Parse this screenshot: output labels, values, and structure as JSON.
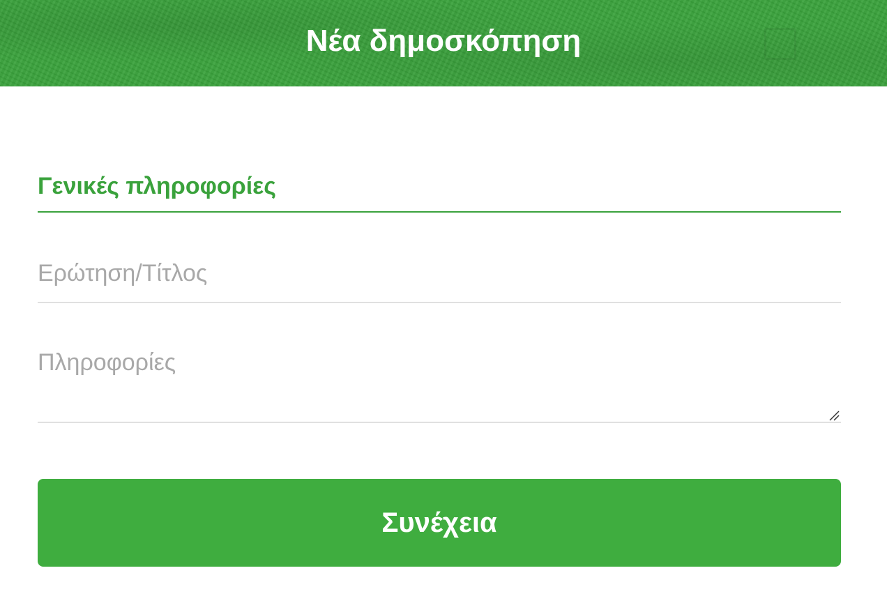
{
  "header": {
    "title": "Νέα δημοσκόπηση"
  },
  "form": {
    "section_title": "Γενικές πληροφορίες",
    "title_field": {
      "placeholder": "Ερώτηση/Τίτλος",
      "value": ""
    },
    "info_field": {
      "placeholder": "Πληροφορίες",
      "value": ""
    },
    "continue_label": "Συνέχεια"
  },
  "colors": {
    "brand_green": "#3aa23c",
    "button_green": "#3fad3f",
    "placeholder_gray": "#a8a8a8",
    "divider_gray": "#e0e0e0"
  },
  "icons": {
    "resize": "resize-handle-icon"
  }
}
